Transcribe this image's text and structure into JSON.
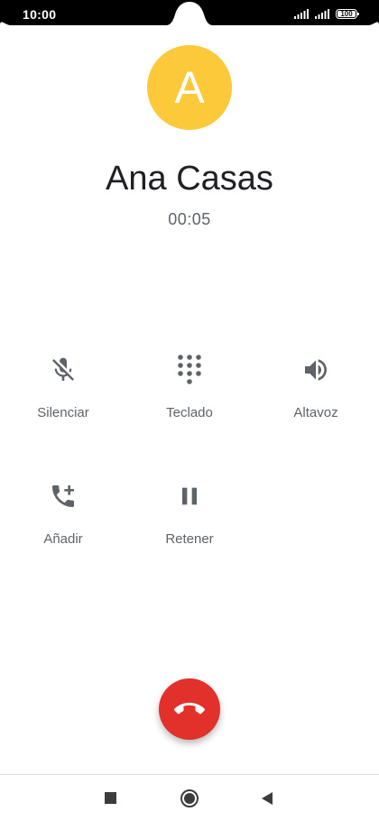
{
  "status_bar": {
    "time": "10:00",
    "battery_level": "100",
    "icons": [
      "signal-icon",
      "signal-icon",
      "battery-icon"
    ]
  },
  "contact": {
    "initial": "A",
    "name": "Ana Casas",
    "avatar_color": "#fbc93a"
  },
  "call": {
    "duration": "00:05"
  },
  "controls": [
    {
      "label": "Silenciar",
      "icon": "microphone-off-icon"
    },
    {
      "label": "Teclado",
      "icon": "dialpad-icon"
    },
    {
      "label": "Altavoz",
      "icon": "speaker-icon"
    },
    {
      "label": "Añadir",
      "icon": "add-call-icon"
    },
    {
      "label": "Retener",
      "icon": "pause-icon"
    }
  ],
  "end_call": {
    "icon": "hang-up-icon",
    "color": "#e2302b"
  },
  "nav_bar": {
    "buttons": [
      "recents-square-icon",
      "home-circle-icon",
      "back-triangle-icon"
    ]
  }
}
